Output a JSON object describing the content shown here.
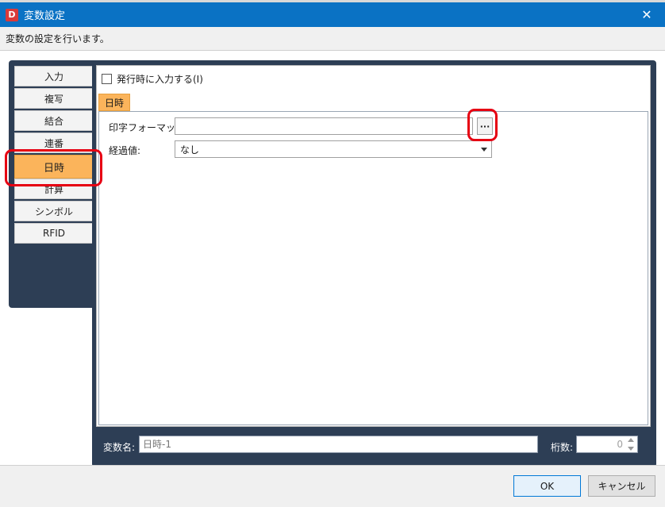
{
  "window": {
    "icon_letter": "D",
    "title": "変数設定",
    "close_glyph": "✕"
  },
  "description": "変数の設定を行います。",
  "nav": {
    "items": [
      {
        "label": "入力"
      },
      {
        "label": "複写"
      },
      {
        "label": "結合"
      },
      {
        "label": "連番"
      },
      {
        "label": "日時",
        "active": true
      },
      {
        "label": "計算"
      },
      {
        "label": "シンボル"
      },
      {
        "label": "RFID"
      }
    ]
  },
  "main": {
    "input_on_issue_label": "発行時に入力する(I)",
    "input_on_issue_checked": false,
    "tab_label": "日時",
    "print_format_label": "印字フォーマット:",
    "print_format_value": "",
    "browse_button_label": "···",
    "elapsed_label": "経過値:",
    "elapsed_value": "なし"
  },
  "bottom": {
    "var_name_label": "変数名:",
    "var_name_placeholder": "日時-1",
    "digits_label": "桁数:",
    "digits_value": "0"
  },
  "footer": {
    "ok_label": "OK",
    "cancel_label": "キャンセル"
  },
  "colors": {
    "titlebar": "#0a72c4",
    "panel": "#2d3e55",
    "active_tab": "#fbb45b",
    "highlight": "#e60012"
  }
}
